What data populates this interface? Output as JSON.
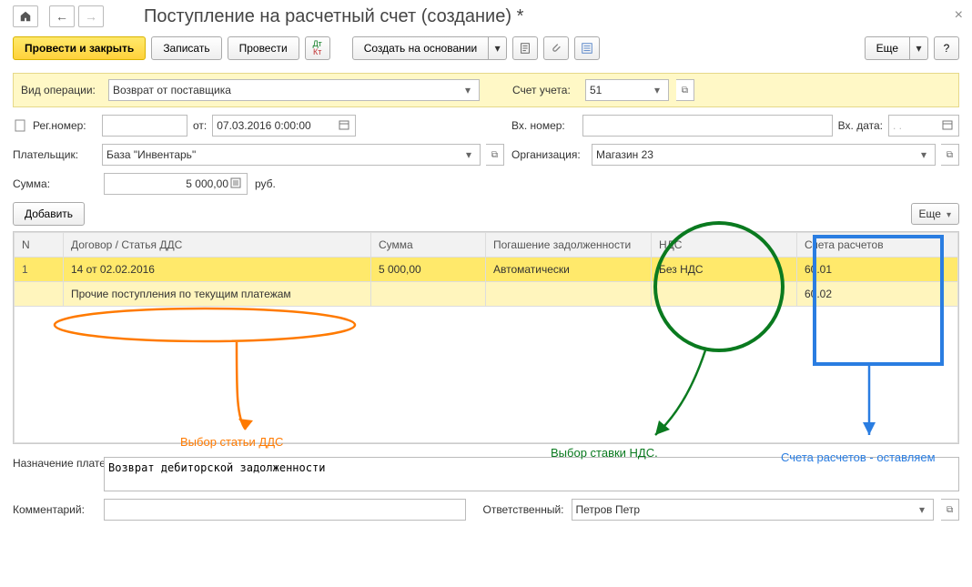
{
  "header": {
    "title": "Поступление на расчетный счет (создание) *"
  },
  "toolbar": {
    "commit_close": "Провести и закрыть",
    "save": "Записать",
    "commit": "Провести",
    "create_based": "Создать на основании",
    "more": "Еще",
    "help": "?"
  },
  "form": {
    "operation_type_label": "Вид операции:",
    "operation_type": "Возврат от поставщика",
    "account_label": "Счет учета:",
    "account": "51",
    "reg_number_label": "Рег.номер:",
    "reg_number": "",
    "date_label": "от:",
    "date": "07.03.2016  0:00:00",
    "in_number_label": "Вх. номер:",
    "in_number": "",
    "in_date_label": "Вх. дата:",
    "in_date": "  .  .  ",
    "payer_label": "Плательщик:",
    "payer": "База \"Инвентарь\"",
    "org_label": "Организация:",
    "org": "Магазин 23",
    "sum_label": "Сумма:",
    "sum": "5 000,00",
    "currency": "руб.",
    "add_btn": "Добавить",
    "table_more": "Еще",
    "purpose_label": "Назначение платежа:",
    "purpose": "Возврат дебиторской задолженности",
    "comment_label": "Комментарий:",
    "comment": "",
    "responsible_label": "Ответственный:",
    "responsible": "Петров Петр"
  },
  "table": {
    "cols": {
      "n": "N",
      "contract": "Договор / Статья ДДС",
      "sum": "Сумма",
      "debt": "Погашение задолженности",
      "vat": "НДС",
      "accounts": "Счета расчетов"
    },
    "rows": [
      {
        "n": "1",
        "contract": "14 от 02.02.2016",
        "sum": "5 000,00",
        "debt": "Автоматически",
        "vat": "Без НДС",
        "accounts": "60.01"
      },
      {
        "n": "",
        "contract": "Прочие поступления по текущим платежам",
        "sum": "",
        "debt": "",
        "vat": "",
        "accounts": "60.02"
      }
    ]
  },
  "annotations": {
    "dds": "Выбор статьи ДДС",
    "vat": "Выбор ставки НДС.",
    "accounts": "Счета расчетов - оставляем"
  }
}
